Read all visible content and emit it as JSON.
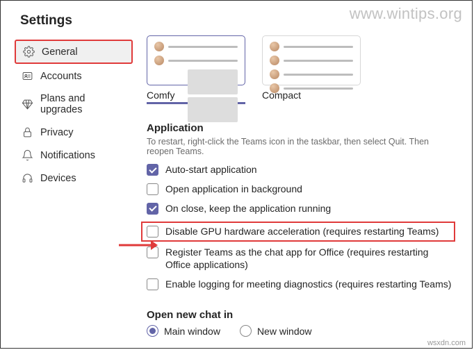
{
  "watermark": "www.wintips.org",
  "credits": "wsxdn.com",
  "page_title": "Settings",
  "sidebar": {
    "items": [
      {
        "label": "General"
      },
      {
        "label": "Accounts"
      },
      {
        "label": "Plans and upgrades"
      },
      {
        "label": "Privacy"
      },
      {
        "label": "Notifications"
      },
      {
        "label": "Devices"
      }
    ]
  },
  "themes": {
    "comfy": "Comfy",
    "compact": "Compact"
  },
  "application": {
    "title": "Application",
    "subtitle": "To restart, right-click the Teams icon in the taskbar, then select Quit. Then reopen Teams.",
    "options": [
      {
        "label": "Auto-start application",
        "checked": true
      },
      {
        "label": "Open application in background",
        "checked": false
      },
      {
        "label": "On close, keep the application running",
        "checked": true
      },
      {
        "label": "Disable GPU hardware acceleration (requires restarting Teams)",
        "checked": false
      },
      {
        "label": "Register Teams as the chat app for Office (requires restarting Office applications)",
        "checked": false
      },
      {
        "label": "Enable logging for meeting diagnostics (requires restarting Teams)",
        "checked": false
      }
    ]
  },
  "open_chat": {
    "title": "Open new chat in",
    "options": [
      {
        "label": "Main window",
        "checked": true
      },
      {
        "label": "New window",
        "checked": false
      }
    ]
  }
}
